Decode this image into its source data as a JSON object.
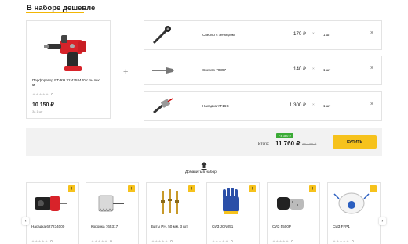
{
  "title": "В наборе дешевле",
  "main_product": {
    "name": "Перфоратор RT-RH 32 4258440 с пылью­м",
    "name_full": "Перфоратор RT-RH 32 4258440 с пылью\nм",
    "rating_count": "0",
    "price": "10 150 ₽",
    "unit": "За 1 шт"
  },
  "plus": "+",
  "accessories": [
    {
      "name": "Сверло с зенкером",
      "price": "170 ₽",
      "x": "×",
      "qty": "1 шт",
      "remove": "×"
    },
    {
      "name": "Сверло 70397",
      "price": "140 ₽",
      "x": "×",
      "qty": "1 шт",
      "remove": "×"
    },
    {
      "name": "Насадка YT16C",
      "price": "1 300 ₽",
      "x": "×",
      "qty": "1 шт",
      "remove": "×"
    }
  ],
  "summary": {
    "discount": "−4 360 ₽",
    "total_label": "Итого:",
    "total": "11 760 ₽",
    "old_price": "16 120 ₽",
    "buy": "КУПИТЬ"
  },
  "add_to_set": "Добавить в набор",
  "products": [
    {
      "name": "Насадка 627234000",
      "rating": "0"
    },
    {
      "name": "Коронка 765317",
      "rating": "0"
    },
    {
      "name": "Биты PH, 50 мм, 3 шт.",
      "rating": "0"
    },
    {
      "name": "СИЗ JCN051",
      "rating": "0"
    },
    {
      "name": "СИЗ 5500P",
      "rating": "0"
    },
    {
      "name": "СИЗ FFP1",
      "rating": "0"
    }
  ],
  "icons": {
    "prev": "arrow-left-icon",
    "next": "arrow-right-icon"
  },
  "colors": {
    "accent": "#f6c21c",
    "discount": "#3aaa35"
  }
}
